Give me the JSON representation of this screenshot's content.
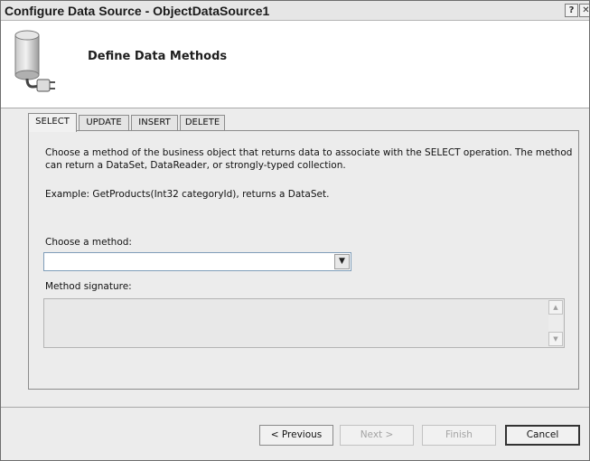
{
  "window": {
    "title": "Configure Data Source - ObjectDataSource1",
    "help_icon": "help-icon",
    "close_icon": "close-icon"
  },
  "header": {
    "title": "Define Data Methods",
    "icon": "database-plug-icon"
  },
  "tabs": [
    {
      "label": "SELECT",
      "active": true
    },
    {
      "label": "UPDATE",
      "active": false
    },
    {
      "label": "INSERT",
      "active": false
    },
    {
      "label": "DELETE",
      "active": false
    }
  ],
  "panel": {
    "description": "Choose a method of the business object that returns data to associate with the SELECT operation. The method can return a DataSet, DataReader, or strongly-typed collection.",
    "example": "Example: GetProducts(Int32 categoryId), returns a DataSet.",
    "choose_method_label": "Choose a method:",
    "method_select_value": "",
    "method_signature_label": "Method signature:",
    "method_signature_value": ""
  },
  "buttons": {
    "previous": "< Previous",
    "next": "Next >",
    "finish": "Finish",
    "cancel": "Cancel"
  }
}
